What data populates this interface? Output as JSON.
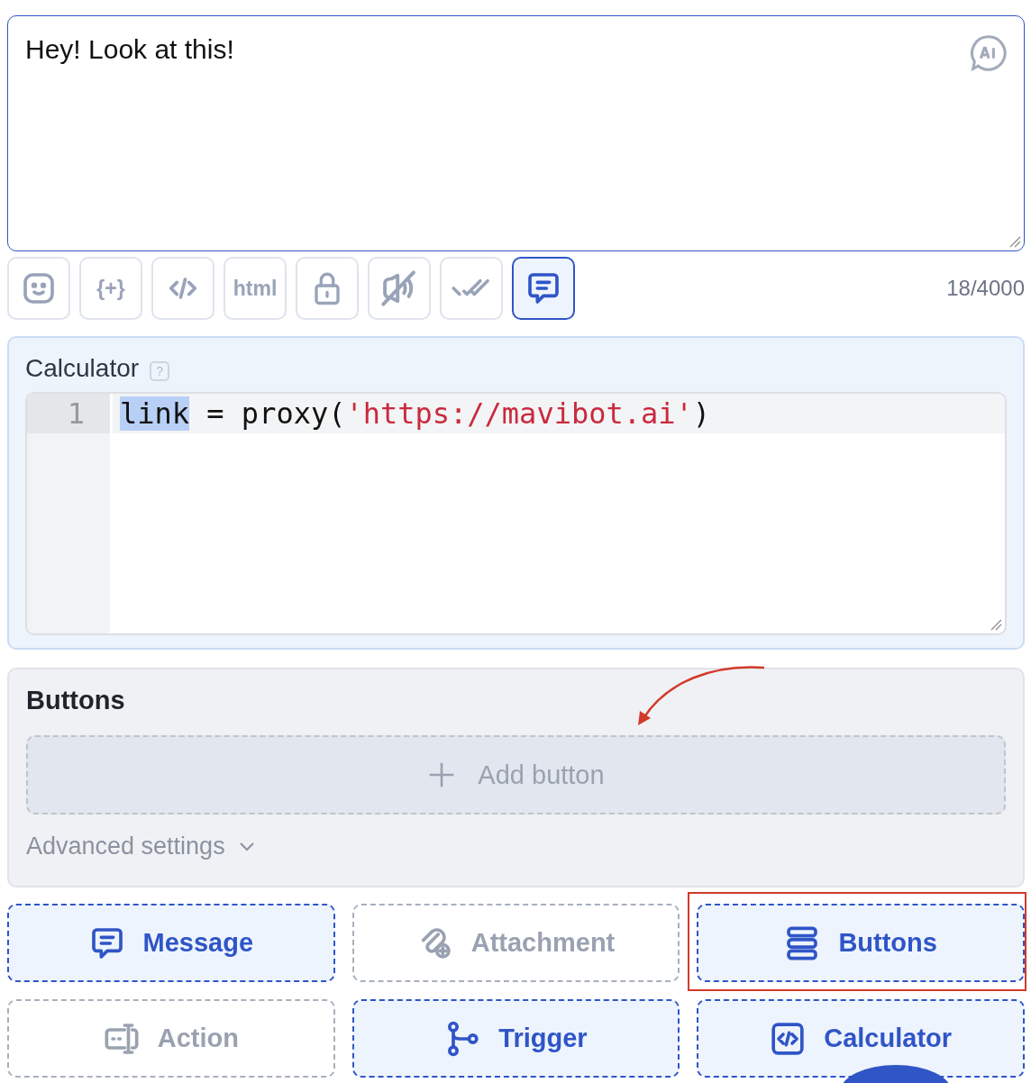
{
  "message": {
    "value": "Hey! Look at this!"
  },
  "toolbar": {
    "tools": [
      {
        "kind": "emoji",
        "selected": false
      },
      {
        "kind": "variable",
        "label": "{+}",
        "selected": false
      },
      {
        "kind": "code",
        "selected": false
      },
      {
        "kind": "html",
        "label": "html",
        "selected": false
      },
      {
        "kind": "lock",
        "selected": false
      },
      {
        "kind": "mute",
        "selected": false
      },
      {
        "kind": "read",
        "selected": false
      },
      {
        "kind": "comment",
        "selected": true
      }
    ],
    "counter": "18/4000"
  },
  "calculator": {
    "title": "Calculator",
    "help": "?",
    "lines": [
      {
        "number": "1",
        "tokens": [
          {
            "text": "link",
            "kind": "selected"
          },
          {
            "text": " = proxy(",
            "kind": "plain"
          },
          {
            "text": "'https://mavibot.ai'",
            "kind": "string"
          },
          {
            "text": ")",
            "kind": "plain"
          }
        ]
      }
    ]
  },
  "buttons_panel": {
    "title": "Buttons",
    "add_label": "Add button",
    "advanced": "Advanced settings"
  },
  "blocks": [
    {
      "kind": "message",
      "label": "Message",
      "active": true,
      "highlighted": false
    },
    {
      "kind": "attachment",
      "label": "Attachment",
      "active": false,
      "highlighted": false
    },
    {
      "kind": "buttons",
      "label": "Buttons",
      "active": true,
      "highlighted": true
    },
    {
      "kind": "action",
      "label": "Action",
      "active": false,
      "highlighted": false
    },
    {
      "kind": "trigger",
      "label": "Trigger",
      "active": true,
      "highlighted": false
    },
    {
      "kind": "calculator",
      "label": "Calculator",
      "active": true,
      "highlighted": false
    }
  ]
}
